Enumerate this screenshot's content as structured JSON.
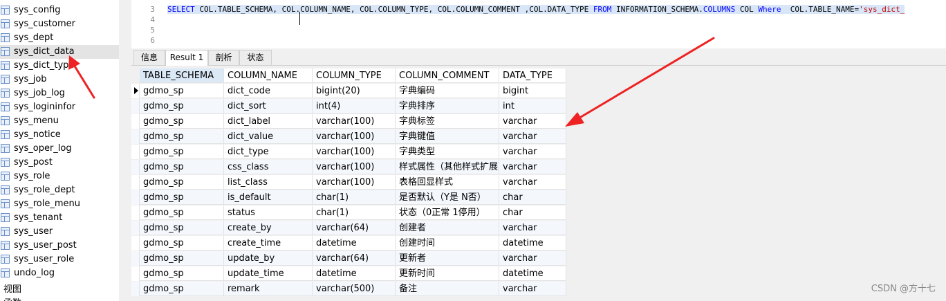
{
  "tree": {
    "tables": [
      "sys_config",
      "sys_customer",
      "sys_dept",
      "sys_dict_data",
      "sys_dict_type",
      "sys_job",
      "sys_job_log",
      "sys_logininfor",
      "sys_menu",
      "sys_notice",
      "sys_oper_log",
      "sys_post",
      "sys_role",
      "sys_role_dept",
      "sys_role_menu",
      "sys_tenant",
      "sys_user",
      "sys_user_post",
      "sys_user_role",
      "undo_log"
    ],
    "selected": "sys_dict_data",
    "groups": [
      "视图",
      "函数"
    ]
  },
  "editor": {
    "line_numbers": [
      "3",
      "4",
      "5",
      "6"
    ],
    "sql_parts": [
      {
        "t": "SELECT",
        "c": "kw"
      },
      {
        "t": " COL.TABLE_SCHEMA, COL.COLUMN_NAME, COL.COLUMN_TYPE, COL.COLUMN_COMMENT ,COL.DATA_TYPE ",
        "c": ""
      },
      {
        "t": "FROM",
        "c": "kw"
      },
      {
        "t": " INFORMATION_SCHEMA.",
        "c": ""
      },
      {
        "t": "COLUMNS",
        "c": "kw"
      },
      {
        "t": " COL ",
        "c": ""
      },
      {
        "t": "Where",
        "c": "kw"
      },
      {
        "t": "  COL.TABLE_NAME=",
        "c": ""
      },
      {
        "t": "'sys_dict_",
        "c": "str"
      }
    ]
  },
  "tabs": [
    "信息",
    "Result 1",
    "剖析",
    "状态"
  ],
  "active_tab": "Result 1",
  "result": {
    "columns": [
      "TABLE_SCHEMA",
      "COLUMN_NAME",
      "COLUMN_TYPE",
      "COLUMN_COMMENT",
      "DATA_TYPE"
    ],
    "rows": [
      [
        "gdmo_sp",
        "dict_code",
        "bigint(20)",
        "字典编码",
        "bigint"
      ],
      [
        "gdmo_sp",
        "dict_sort",
        "int(4)",
        "字典排序",
        "int"
      ],
      [
        "gdmo_sp",
        "dict_label",
        "varchar(100)",
        "字典标签",
        "varchar"
      ],
      [
        "gdmo_sp",
        "dict_value",
        "varchar(100)",
        "字典键值",
        "varchar"
      ],
      [
        "gdmo_sp",
        "dict_type",
        "varchar(100)",
        "字典类型",
        "varchar"
      ],
      [
        "gdmo_sp",
        "css_class",
        "varchar(100)",
        "样式属性（其他样式扩展）",
        "varchar"
      ],
      [
        "gdmo_sp",
        "list_class",
        "varchar(100)",
        "表格回显样式",
        "varchar"
      ],
      [
        "gdmo_sp",
        "is_default",
        "char(1)",
        "是否默认（Y是 N否）",
        "char"
      ],
      [
        "gdmo_sp",
        "status",
        "char(1)",
        "状态（0正常 1停用）",
        "char"
      ],
      [
        "gdmo_sp",
        "create_by",
        "varchar(64)",
        "创建者",
        "varchar"
      ],
      [
        "gdmo_sp",
        "create_time",
        "datetime",
        "创建时间",
        "datetime"
      ],
      [
        "gdmo_sp",
        "update_by",
        "varchar(64)",
        "更新者",
        "varchar"
      ],
      [
        "gdmo_sp",
        "update_time",
        "datetime",
        "更新时间",
        "datetime"
      ],
      [
        "gdmo_sp",
        "remark",
        "varchar(500)",
        "备注",
        "varchar"
      ]
    ]
  },
  "watermark": "CSDN @方十七",
  "colors": {
    "annotation_arrow": "#ee2222",
    "sql_keyword": "#0000ff",
    "sql_string": "#c00000",
    "header_highlight": "#dbe8f6"
  }
}
